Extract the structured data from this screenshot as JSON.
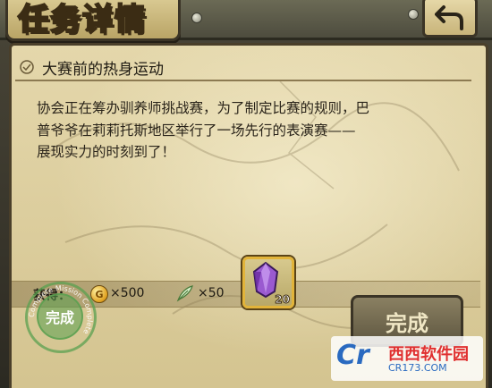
{
  "header": {
    "title": "任务详情"
  },
  "quest": {
    "title": "大赛前的热身运动",
    "description": "协会正在筹办驯养师挑战赛，为了制定比赛的规则，巴\n普爷爷在莉莉托斯地区举行了一场先行的表演赛——\n展现实力的时刻到了！"
  },
  "rewards": {
    "label": "获得：",
    "coin_icon_glyph": "G",
    "coin_amount": "×500",
    "feather_amount": "×50",
    "gem_count": "20"
  },
  "stamp": {
    "label": "完成",
    "ring_text": "Complete Mission Complete"
  },
  "actions": {
    "complete_label": "完成"
  },
  "watermark": {
    "logo": "Cr",
    "name": "西西软件园",
    "url": "CR173.COM"
  },
  "colors": {
    "parchment": "#d4c490",
    "frame": "#4a3f2a",
    "stamp": "#5aa050",
    "gem": "#9a5ad0"
  },
  "icons": [
    "back-arrow-icon",
    "coin-icon",
    "feather-icon",
    "purple-gem-icon",
    "quest-bullet-icon"
  ]
}
